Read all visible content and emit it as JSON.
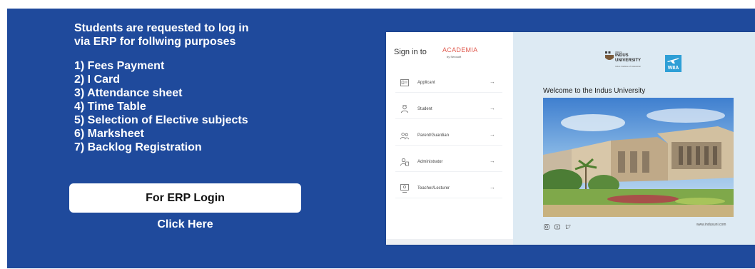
{
  "left_panel": {
    "intro_line1": "Students are requested to log in",
    "intro_line2": "via ERP for follwing purposes",
    "purposes": [
      "1) Fees Payment",
      "2) I Card",
      "3) Attendance sheet",
      "4) Time Table",
      "5) Selection of Elective subjects",
      "6) Marksheet",
      "7) Backlog Registration"
    ],
    "login_button_label": "For ERP Login",
    "click_here_label": "Click Here"
  },
  "preview": {
    "signin": {
      "heading": "Sign in to",
      "brand": "ACADEMIA",
      "brand_sub": "by Serosoft",
      "roles": [
        {
          "label": "Applicant",
          "icon": "id-card-icon"
        },
        {
          "label": "Student",
          "icon": "student-icon"
        },
        {
          "label": "Parent/Guardian",
          "icon": "parents-icon"
        },
        {
          "label": "Administrator",
          "icon": "admin-icon"
        },
        {
          "label": "Teacher/Lecturer",
          "icon": "teacher-icon"
        }
      ]
    },
    "welcome": {
      "logo_small": "INDUS",
      "logo_line1": "INDUS",
      "logo_line2": "UNIVERSITY",
      "logo_tagline": "Indus Institute of Education",
      "badge_label": "WIIA",
      "title": "Welcome to the Indus University",
      "social_icons": [
        "instagram-icon",
        "youtube-icon",
        "twitter-icon"
      ],
      "website": "www.indusuni.com"
    }
  },
  "colors": {
    "banner_bg": "#1f4a9c",
    "welcome_bg": "#ddeaf3",
    "academia_brand": "#e05a4e",
    "badge_bg": "#2e9fd6"
  }
}
